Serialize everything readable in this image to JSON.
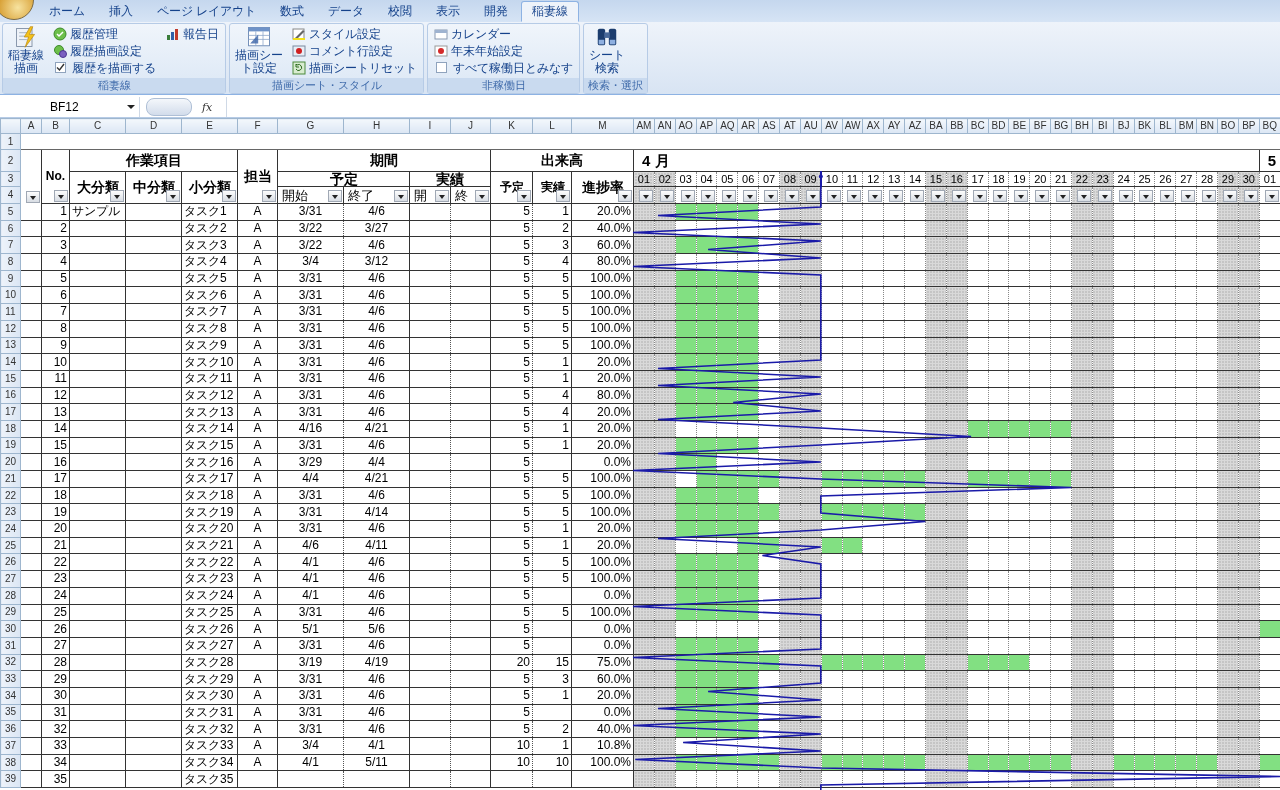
{
  "ribbon_tabs": [
    {
      "label": "ホーム",
      "selected": false
    },
    {
      "label": "挿入",
      "selected": false
    },
    {
      "label": "ページ レイアウト",
      "selected": false
    },
    {
      "label": "数式",
      "selected": false
    },
    {
      "label": "データ",
      "selected": false
    },
    {
      "label": "校閲",
      "selected": false
    },
    {
      "label": "表示",
      "selected": false
    },
    {
      "label": "開発",
      "selected": false
    },
    {
      "label": "稲妻線",
      "selected": true
    }
  ],
  "ribbon_groups": [
    {
      "label": "稲妻線",
      "columns": [
        [
          {
            "kind": "large",
            "label": "稲妻線描画"
          }
        ],
        [
          {
            "kind": "button",
            "label": "履歴管理"
          },
          {
            "kind": "button",
            "label": "履歴描画設定"
          },
          {
            "kind": "checkbox",
            "label": "履歴を描画する",
            "checked": true
          }
        ],
        [
          {
            "kind": "button",
            "label": "報告日"
          }
        ]
      ]
    },
    {
      "label": "描画シート・スタイル",
      "columns": [
        [
          {
            "kind": "large",
            "label": "描画シート設定"
          }
        ],
        [
          {
            "kind": "button",
            "label": "スタイル設定"
          },
          {
            "kind": "button",
            "label": "コメント行設定"
          },
          {
            "kind": "button",
            "label": "描画シートリセット"
          }
        ]
      ]
    },
    {
      "label": "非稼働日",
      "columns": [
        [
          {
            "kind": "button",
            "label": "カレンダー"
          },
          {
            "kind": "button",
            "label": "年末年始設定"
          },
          {
            "kind": "checkbox",
            "label": "すべて稼働日とみなす",
            "checked": false
          }
        ]
      ]
    },
    {
      "label": "検索・選択",
      "columns": [
        [
          {
            "kind": "large",
            "label": "シート検索"
          }
        ]
      ]
    }
  ],
  "formula_bar": {
    "name_box": "BF12",
    "function_label": "fx"
  },
  "column_letters": [
    "A",
    "B",
    "C",
    "D",
    "E",
    "F",
    "G",
    "H",
    "I",
    "J",
    "K",
    "L",
    "M",
    "AM",
    "AN",
    "AO",
    "AP",
    "AQ",
    "AR",
    "AS",
    "AT",
    "AU",
    "AV",
    "AW",
    "AX",
    "AY",
    "AZ",
    "BA",
    "BB",
    "BC",
    "BD",
    "BE",
    "BF",
    "BG",
    "BH",
    "BI",
    "BJ",
    "BK",
    "BL",
    "BM",
    "BN",
    "BO",
    "BP",
    "BQ"
  ],
  "row_numbers": [
    "1",
    "2",
    "3",
    "4",
    "5",
    "6",
    "7",
    "8",
    "9",
    "10",
    "11",
    "12",
    "13",
    "14",
    "15",
    "16",
    "17",
    "18",
    "19",
    "20",
    "21",
    "22",
    "23",
    "24",
    "25",
    "26",
    "27",
    "28",
    "29",
    "30",
    "31",
    "32",
    "33",
    "34",
    "35",
    "36",
    "37",
    "38",
    "39"
  ],
  "headers": {
    "no": "No.",
    "work_item": "作業項目",
    "major": "大分類",
    "middle": "中分類",
    "minor": "小分類",
    "owner": "担当",
    "period": "期間",
    "planned": "予定",
    "planned_start": "開始",
    "planned_end": "終了",
    "actual": "実績",
    "actual_start": "開",
    "actual_end": "終",
    "output": "出来高",
    "output_planned": "予定",
    "output_actual": "実績",
    "progress": "進捗率"
  },
  "month_labels": [
    "4 月",
    "5"
  ],
  "days": [
    {
      "label": "01",
      "holiday": true,
      "report_line": false
    },
    {
      "label": "02",
      "holiday": true,
      "report_line": false
    },
    {
      "label": "03",
      "holiday": false,
      "report_line": false
    },
    {
      "label": "04",
      "holiday": false,
      "report_line": false
    },
    {
      "label": "05",
      "holiday": false,
      "report_line": false
    },
    {
      "label": "06",
      "holiday": false,
      "report_line": false
    },
    {
      "label": "07",
      "holiday": false,
      "report_line": false
    },
    {
      "label": "08",
      "holiday": true,
      "report_line": false
    },
    {
      "label": "09",
      "holiday": true,
      "report_line": true
    },
    {
      "label": "10",
      "holiday": false,
      "report_line": false
    },
    {
      "label": "11",
      "holiday": false,
      "report_line": false
    },
    {
      "label": "12",
      "holiday": false,
      "report_line": false
    },
    {
      "label": "13",
      "holiday": false,
      "report_line": false
    },
    {
      "label": "14",
      "holiday": false,
      "report_line": false
    },
    {
      "label": "15",
      "holiday": true,
      "report_line": false
    },
    {
      "label": "16",
      "holiday": true,
      "report_line": false
    },
    {
      "label": "17",
      "holiday": false,
      "report_line": false
    },
    {
      "label": "18",
      "holiday": false,
      "report_line": false
    },
    {
      "label": "19",
      "holiday": false,
      "report_line": false
    },
    {
      "label": "20",
      "holiday": false,
      "report_line": false
    },
    {
      "label": "21",
      "holiday": false,
      "report_line": false
    },
    {
      "label": "22",
      "holiday": true,
      "report_line": false
    },
    {
      "label": "23",
      "holiday": true,
      "report_line": false
    },
    {
      "label": "24",
      "holiday": false,
      "report_line": false
    },
    {
      "label": "25",
      "holiday": false,
      "report_line": false
    },
    {
      "label": "26",
      "holiday": false,
      "report_line": false
    },
    {
      "label": "27",
      "holiday": false,
      "report_line": false
    },
    {
      "label": "28",
      "holiday": false,
      "report_line": false
    },
    {
      "label": "29",
      "holiday": true,
      "report_line": false
    },
    {
      "label": "30",
      "holiday": true,
      "report_line": false
    },
    {
      "label": "01",
      "holiday": false,
      "report_line": false
    }
  ],
  "tasks": [
    {
      "no": "1",
      "major": "サンプル",
      "item": "タスク1",
      "owner": "A",
      "start": "3/31",
      "end": "4/6",
      "output_planned": "5",
      "output_actual": "1",
      "progress": "20.0%"
    },
    {
      "no": "2",
      "item": "タスク2",
      "owner": "A",
      "start": "3/22",
      "end": "3/27",
      "output_planned": "5",
      "output_actual": "2",
      "progress": "40.0%"
    },
    {
      "no": "3",
      "item": "タスク3",
      "owner": "A",
      "start": "3/22",
      "end": "4/6",
      "output_planned": "5",
      "output_actual": "3",
      "progress": "60.0%"
    },
    {
      "no": "4",
      "item": "タスク4",
      "owner": "A",
      "start": "3/4",
      "end": "3/12",
      "output_planned": "5",
      "output_actual": "4",
      "progress": "80.0%"
    },
    {
      "no": "5",
      "item": "タスク5",
      "owner": "A",
      "start": "3/31",
      "end": "4/6",
      "output_planned": "5",
      "output_actual": "5",
      "progress": "100.0%"
    },
    {
      "no": "6",
      "item": "タスク6",
      "owner": "A",
      "start": "3/31",
      "end": "4/6",
      "output_planned": "5",
      "output_actual": "5",
      "progress": "100.0%"
    },
    {
      "no": "7",
      "item": "タスク7",
      "owner": "A",
      "start": "3/31",
      "end": "4/6",
      "output_planned": "5",
      "output_actual": "5",
      "progress": "100.0%"
    },
    {
      "no": "8",
      "item": "タスク8",
      "owner": "A",
      "start": "3/31",
      "end": "4/6",
      "output_planned": "5",
      "output_actual": "5",
      "progress": "100.0%"
    },
    {
      "no": "9",
      "item": "タスク9",
      "owner": "A",
      "start": "3/31",
      "end": "4/6",
      "output_planned": "5",
      "output_actual": "5",
      "progress": "100.0%"
    },
    {
      "no": "10",
      "item": "タスク10",
      "owner": "A",
      "start": "3/31",
      "end": "4/6",
      "output_planned": "5",
      "output_actual": "1",
      "progress": "20.0%"
    },
    {
      "no": "11",
      "item": "タスク11",
      "owner": "A",
      "start": "3/31",
      "end": "4/6",
      "output_planned": "5",
      "output_actual": "1",
      "progress": "20.0%"
    },
    {
      "no": "12",
      "item": "タスク12",
      "owner": "A",
      "start": "3/31",
      "end": "4/6",
      "output_planned": "5",
      "output_actual": "4",
      "progress": "80.0%"
    },
    {
      "no": "13",
      "item": "タスク13",
      "owner": "A",
      "start": "3/31",
      "end": "4/6",
      "output_planned": "5",
      "output_actual": "4",
      "progress": "20.0%"
    },
    {
      "no": "14",
      "item": "タスク14",
      "owner": "A",
      "start": "4/16",
      "end": "4/21",
      "output_planned": "5",
      "output_actual": "1",
      "progress": "20.0%"
    },
    {
      "no": "15",
      "item": "タスク15",
      "owner": "A",
      "start": "3/31",
      "end": "4/6",
      "output_planned": "5",
      "output_actual": "1",
      "progress": "20.0%"
    },
    {
      "no": "16",
      "item": "タスク16",
      "owner": "A",
      "start": "3/29",
      "end": "4/4",
      "output_planned": "5",
      "progress": "0.0%"
    },
    {
      "no": "17",
      "item": "タスク17",
      "owner": "A",
      "start": "4/4",
      "end": "4/21",
      "output_planned": "5",
      "output_actual": "5",
      "progress": "100.0%"
    },
    {
      "no": "18",
      "item": "タスク18",
      "owner": "A",
      "start": "3/31",
      "end": "4/6",
      "output_planned": "5",
      "output_actual": "5",
      "progress": "100.0%"
    },
    {
      "no": "19",
      "item": "タスク19",
      "owner": "A",
      "start": "3/31",
      "end": "4/14",
      "output_planned": "5",
      "output_actual": "5",
      "progress": "100.0%"
    },
    {
      "no": "20",
      "item": "タスク20",
      "owner": "A",
      "start": "3/31",
      "end": "4/6",
      "output_planned": "5",
      "output_actual": "1",
      "progress": "20.0%"
    },
    {
      "no": "21",
      "item": "タスク21",
      "owner": "A",
      "start": "4/6",
      "end": "4/11",
      "output_planned": "5",
      "output_actual": "1",
      "progress": "20.0%"
    },
    {
      "no": "22",
      "item": "タスク22",
      "owner": "A",
      "start": "4/1",
      "end": "4/6",
      "output_planned": "5",
      "output_actual": "5",
      "progress": "100.0%"
    },
    {
      "no": "23",
      "item": "タスク23",
      "owner": "A",
      "start": "4/1",
      "end": "4/6",
      "output_planned": "5",
      "output_actual": "5",
      "progress": "100.0%"
    },
    {
      "no": "24",
      "item": "タスク24",
      "owner": "A",
      "start": "4/1",
      "end": "4/6",
      "output_planned": "5",
      "progress": "0.0%"
    },
    {
      "no": "25",
      "item": "タスク25",
      "owner": "A",
      "start": "3/31",
      "end": "4/6",
      "output_planned": "5",
      "output_actual": "5",
      "progress": "100.0%"
    },
    {
      "no": "26",
      "item": "タスク26",
      "owner": "A",
      "start": "5/1",
      "end": "5/6",
      "output_planned": "5",
      "progress": "0.0%"
    },
    {
      "no": "27",
      "item": "タスク27",
      "owner": "A",
      "start": "3/31",
      "end": "4/6",
      "output_planned": "5",
      "progress": "0.0%"
    },
    {
      "no": "28",
      "item": "タスク28",
      "start": "3/19",
      "end": "4/19",
      "output_planned": "20",
      "output_actual": "15",
      "progress": "75.0%"
    },
    {
      "no": "29",
      "item": "タスク29",
      "owner": "A",
      "start": "3/31",
      "end": "4/6",
      "output_planned": "5",
      "output_actual": "3",
      "progress": "60.0%"
    },
    {
      "no": "30",
      "item": "タスク30",
      "owner": "A",
      "start": "3/31",
      "end": "4/6",
      "output_planned": "5",
      "output_actual": "1",
      "progress": "20.0%"
    },
    {
      "no": "31",
      "item": "タスク31",
      "owner": "A",
      "start": "3/31",
      "end": "4/6",
      "output_planned": "5",
      "progress": "0.0%"
    },
    {
      "no": "32",
      "item": "タスク32",
      "owner": "A",
      "start": "3/31",
      "end": "4/6",
      "output_planned": "5",
      "output_actual": "2",
      "progress": "40.0%"
    },
    {
      "no": "33",
      "item": "タスク33",
      "owner": "A",
      "start": "3/4",
      "end": "4/1",
      "output_planned": "10",
      "output_actual": "1",
      "progress": "10.8%"
    },
    {
      "no": "34",
      "item": "タスク34",
      "owner": "A",
      "start": "4/1",
      "end": "5/11",
      "output_planned": "10",
      "output_actual": "10",
      "progress": "100.0%"
    },
    {
      "no": "35",
      "item": "タスク35"
    }
  ]
}
